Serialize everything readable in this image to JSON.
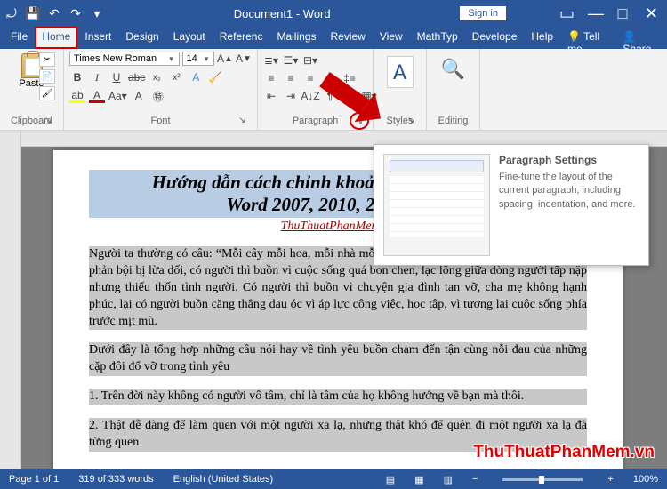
{
  "titlebar": {
    "title": "Document1 - Word",
    "signin": "Sign in"
  },
  "tabs": [
    "File",
    "Home",
    "Insert",
    "Design",
    "Layout",
    "References",
    "Mailings",
    "Review",
    "View",
    "MathType",
    "Developer",
    "Help"
  ],
  "tabs_active_index": 1,
  "tellme": "Tell me",
  "share": "Share",
  "ribbon": {
    "clipboard": {
      "paste": "Paste",
      "label": "Clipboard"
    },
    "font": {
      "name": "Times New Roman",
      "size": "14",
      "label": "Font"
    },
    "paragraph": {
      "label": "Paragraph"
    },
    "styles": {
      "label": "Styles"
    },
    "editing": {
      "label": "Editing"
    }
  },
  "tooltip": {
    "title": "Paragraph Settings",
    "body": "Fine-tune the layout of the current paragraph, including spacing, indentation, and more."
  },
  "document": {
    "title": "Hướng dẫn cách chỉnh khoảng cách dòng trong\nWord 2007, 2010, 2013, 2016",
    "source": "ThuThuatPhanMem.vn",
    "p1": "Người ta thường có câu: “Mỗi cây mỗi hoa, mỗi nhà mỗi cảnh”. Có người thất vọng vì tình yêu bị phản bội bị lừa dối, có người thì buồn vì cuộc sống quá bon chen, lạc lõng giữa dòng người tấp nập nhưng thiếu thốn tình người. Có người thì buồn vì chuyện gia đình tan vỡ, cha mẹ không hạnh phúc, lại có người buồn căng thẳng đau óc vì áp lực công việc, học tập, vì tương lai cuộc sống phía trước mịt mù.",
    "p2": "Dưới đây là tổng hợp những câu nói hay về tình yêu buồn chạm đến tận cùng nỗi đau của những cặp đôi đổ vỡ trong tình yêu",
    "p3": "1. Trên đời này không có người vô tâm, chỉ là tâm của họ không hướng về bạn mà thôi.",
    "p4": "2. Thật dễ dàng để làm quen với một người xa lạ, nhưng thật khó để quên đi một người xa lạ đã từng quen"
  },
  "statusbar": {
    "page": "Page 1 of 1",
    "words": "319 of 333 words",
    "lang": "English (United States)",
    "zoom": "100%"
  },
  "watermark": "ThuThuatPhanMem.vn"
}
